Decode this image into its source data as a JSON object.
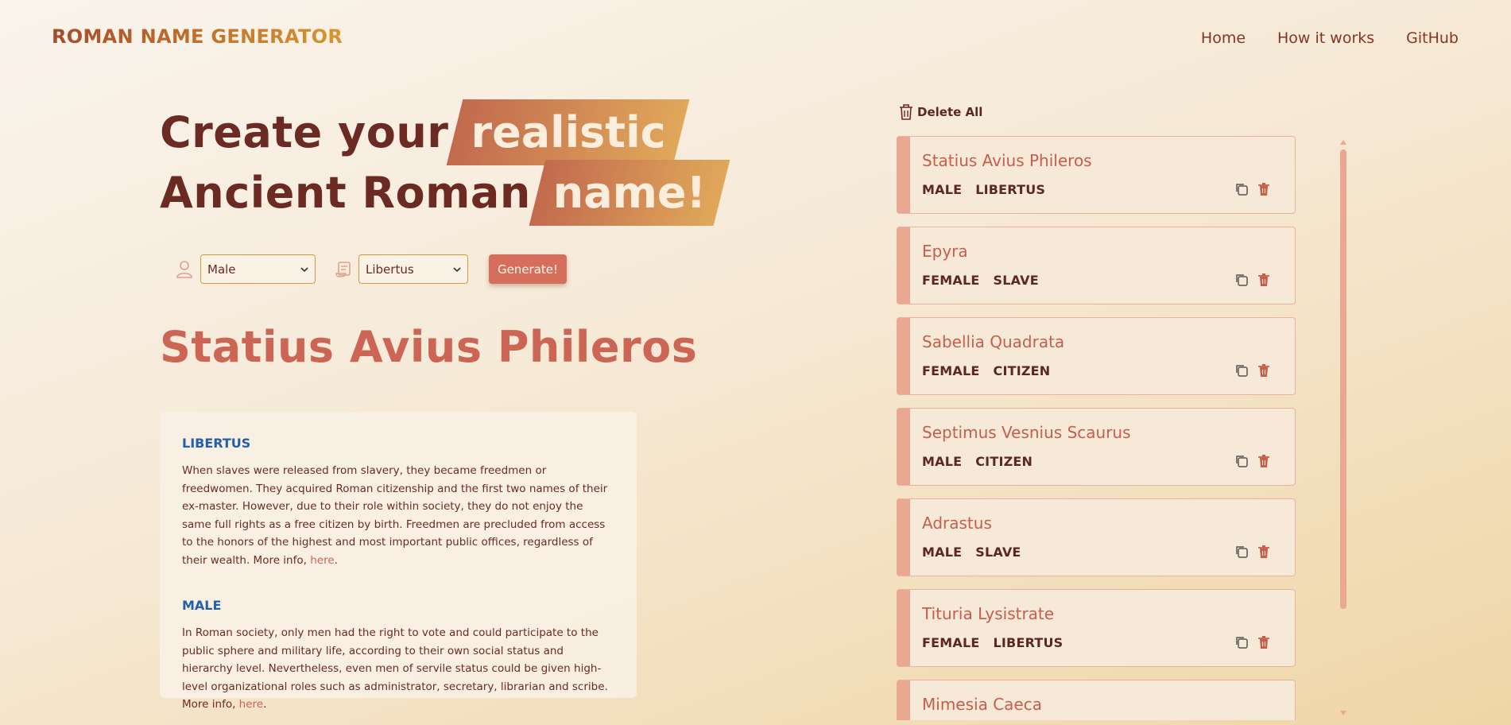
{
  "header": {
    "logo": "ROMAN NAME GENERATOR",
    "nav": [
      "Home",
      "How it works",
      "GitHub"
    ]
  },
  "hero": {
    "line1_plain": "Create your",
    "line1_highlight": "realistic",
    "line2_plain": "Ancient Roman",
    "line2_highlight": "name!"
  },
  "controls": {
    "gender_icon": "person-icon",
    "gender_value": "Male",
    "status_icon": "scroll-icon",
    "status_value": "Libertus",
    "generate_label": "Generate!"
  },
  "result": {
    "name": "Statius Avius Phileros"
  },
  "info": {
    "status_title": "LIBERTUS",
    "status_text": "When slaves were released from slavery, they became freedmen or freedwomen. They acquired Roman citizenship and the first two names of their ex-master. However, due to their role within society, they do not enjoy the same full rights as a free citizen by birth. Freedmen are precluded from access to the honors of the highest and most important public offices, regardless of their wealth. More info, ",
    "status_link": "here",
    "gender_title": "MALE",
    "gender_text": "In Roman society, only men had the right to vote and could participate to the public sphere and military life, according to their own social status and hierarchy level. Nevertheless, even men of servile status could be given high-level organizational roles such as administrator, secretary, librarian and scribe. More info, ",
    "gender_link": "here"
  },
  "history": {
    "delete_all_label": "Delete All",
    "items": [
      {
        "name": "Statius Avius Phileros",
        "gender": "MALE",
        "status": "LIBERTUS"
      },
      {
        "name": "Epyra",
        "gender": "FEMALE",
        "status": "SLAVE"
      },
      {
        "name": "Sabellia Quadrata",
        "gender": "FEMALE",
        "status": "CITIZEN"
      },
      {
        "name": "Septimus Vesnius Scaurus",
        "gender": "MALE",
        "status": "CITIZEN"
      },
      {
        "name": "Adrastus",
        "gender": "MALE",
        "status": "SLAVE"
      },
      {
        "name": "Tituria Lysistrate",
        "gender": "FEMALE",
        "status": "LIBERTUS"
      },
      {
        "name": "Mimesia Caeca",
        "gender": "",
        "status": ""
      }
    ]
  },
  "colors": {
    "accent": "#cc6553",
    "card_border": "#eaa893",
    "info_title": "#2460a8"
  }
}
